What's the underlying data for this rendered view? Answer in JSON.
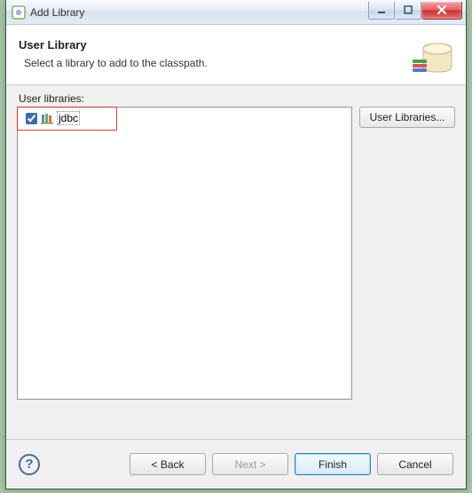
{
  "window": {
    "title": "Add Library"
  },
  "header": {
    "title": "User Library",
    "description": "Select a library to add to the classpath."
  },
  "body": {
    "list_label": "User libraries:",
    "side_button": "User Libraries...",
    "libraries": [
      {
        "name": "jdbc",
        "checked": true
      }
    ]
  },
  "footer": {
    "help_glyph": "?",
    "back": "< Back",
    "next": "Next >",
    "finish": "Finish",
    "cancel": "Cancel"
  }
}
